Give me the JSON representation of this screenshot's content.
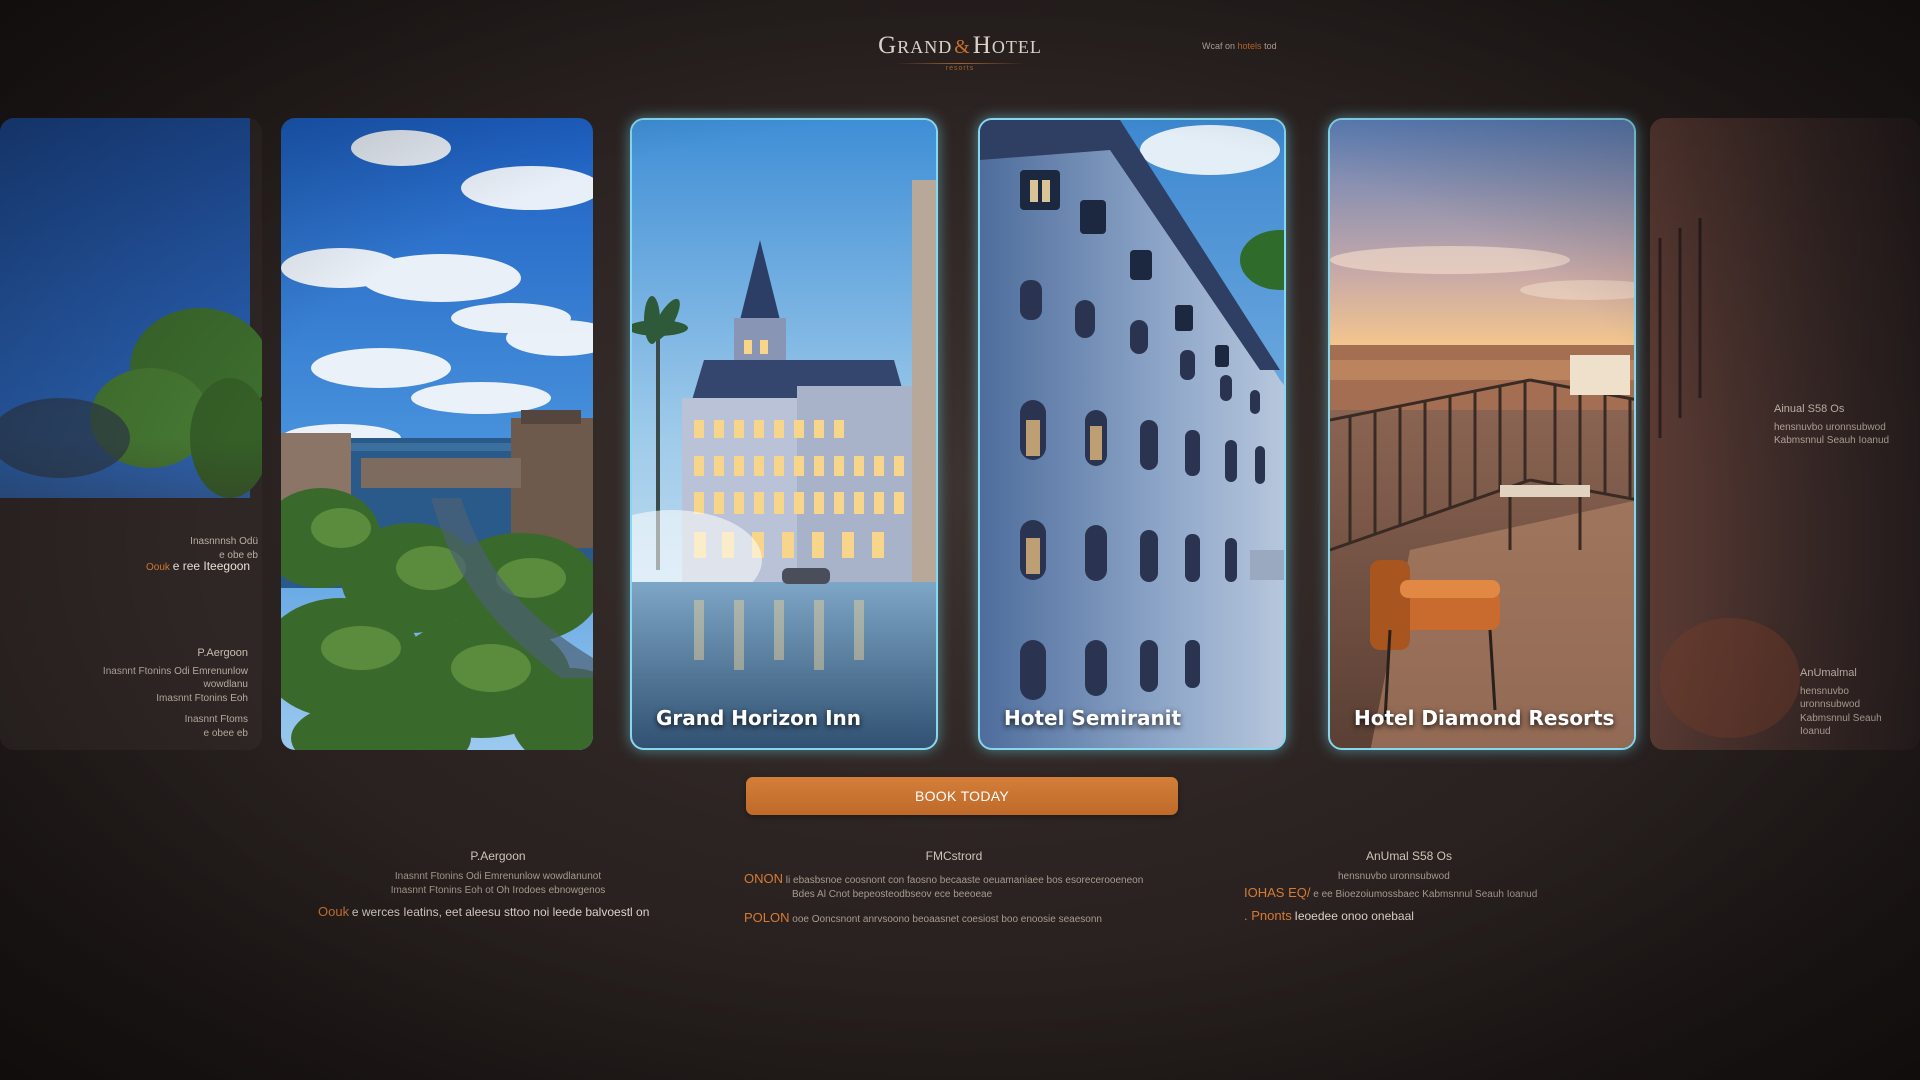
{
  "header": {
    "logo_left": "Grand",
    "logo_amp": "&",
    "logo_right": "Hotel",
    "logo_sub": "resorts",
    "note_prefix": "Wcaf on",
    "note_accent": "hotels",
    "note_suffix": "tod"
  },
  "cards": [
    {
      "title": "Grand Horizon Inn"
    },
    {
      "title": "Hotel Semiranit"
    },
    {
      "title": "Hotel Diamond Resorts"
    }
  ],
  "left_panel": {
    "small1": "Inasnnnsh Odü",
    "small2": "e obe eb",
    "tag_accent": "Oouk",
    "tag_text": "e ree Iteegoon",
    "heading": "P.Aergoon",
    "line1": "Inasnnt Ftonins Odi Emrenunlow wowdlanu",
    "line2": "Imasnnt Ftonins Eoh",
    "line3": "Inasnnt Ftoms",
    "line4": "e obee eb"
  },
  "right_panel": {
    "heading1": "Ainual S58 Os",
    "line1": "hensnuvbo uronnsubwod",
    "line2": "Kabmsnnul Seauh Ioanud",
    "heading2": "AnUmalmal",
    "line3": "hensnuvbo uronnsubwod",
    "line4": "Kabmsnnul Seauh Ioanud"
  },
  "book_button": "BOOK TODAY",
  "info_columns": [
    {
      "heading": "P.Aergoon",
      "line1": "Inasnnt Ftonins Odi Emrenunlow wowdlanunot",
      "line2": "Imasnnt Ftonins Eoh ot Oh Irodoes ebnowgenos",
      "accent": "Oouk",
      "text": "e werces Ieatins, eet aleesu sttoo noi leede balvoestl on"
    },
    {
      "heading": "FMCstrord",
      "accent1": "ONON",
      "text1": "li ebasbsnoe coosnont con faosno becaaste oeuamaniaee bos esorecerooeneon",
      "text1b": "Bdes Al Cnot bepeosteodbseov ece beeoeae",
      "accent2": "POLON",
      "text2": "ooe Ooncsnont anrvsoono beoaasnet coesiost boo enoosie seaesonn"
    },
    {
      "heading": "AnUmal S58 Os",
      "line1": "hensnuvbo uronnsubwod",
      "line2": "Kabmsnnul Seauh Ioanud",
      "accent1": "IOHAS EQ/",
      "text1": "e ee Bioezoiumossbaec",
      "accent2": ". Pnonts",
      "text2": "Ieoedee onoo onebaal"
    }
  ],
  "colors": {
    "accent": "#D77A34",
    "card_glow": "#86D8EE",
    "background": "#2C2422"
  }
}
